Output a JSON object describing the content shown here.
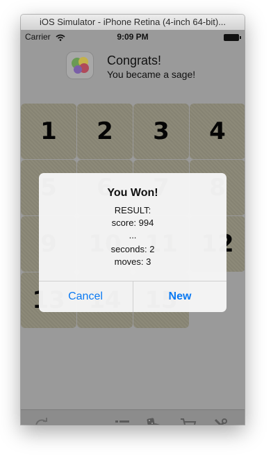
{
  "window": {
    "title": "iOS Simulator - iPhone Retina (4-inch 64-bit)..."
  },
  "status_bar": {
    "carrier": "Carrier",
    "time": "9:09 PM"
  },
  "banner": {
    "title": "Congrats!",
    "subtitle": "You became a sage!"
  },
  "tiles": [
    "1",
    "2",
    "3",
    "4",
    "5",
    "6",
    "7",
    "8",
    "9",
    "10",
    "11",
    "12",
    "13",
    "14",
    "15"
  ],
  "alert": {
    "title": "You Won!",
    "lines": [
      "RESULT:",
      "score: 994",
      "...",
      "seconds: 2",
      "moves: 3"
    ],
    "cancel_label": "Cancel",
    "new_label": "New"
  },
  "toolbar": {
    "icons": [
      "refresh-icon",
      "list-icon",
      "dice-icon",
      "cart-icon",
      "settings-icon"
    ]
  },
  "colors": {
    "alert_button": "#0a79f2",
    "tile": "#8d8a79"
  }
}
